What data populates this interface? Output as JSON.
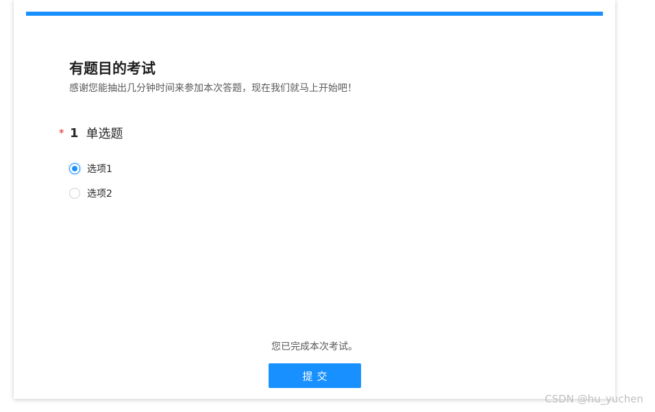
{
  "colors": {
    "accent": "#1890ff",
    "required": "#e02020"
  },
  "survey": {
    "title": "有题目的考试",
    "description": "感谢您能抽出几分钟时间来参加本次答题，现在我们就马上开始吧！"
  },
  "question": {
    "required_mark": "*",
    "number": "1",
    "title": "单选题",
    "options": [
      {
        "label": "选项1",
        "selected": true
      },
      {
        "label": "选项2",
        "selected": false
      }
    ]
  },
  "footer": {
    "finish_text": "您已完成本次考试。",
    "submit_label": "提交"
  },
  "watermark": "CSDN @hu_yuchen"
}
